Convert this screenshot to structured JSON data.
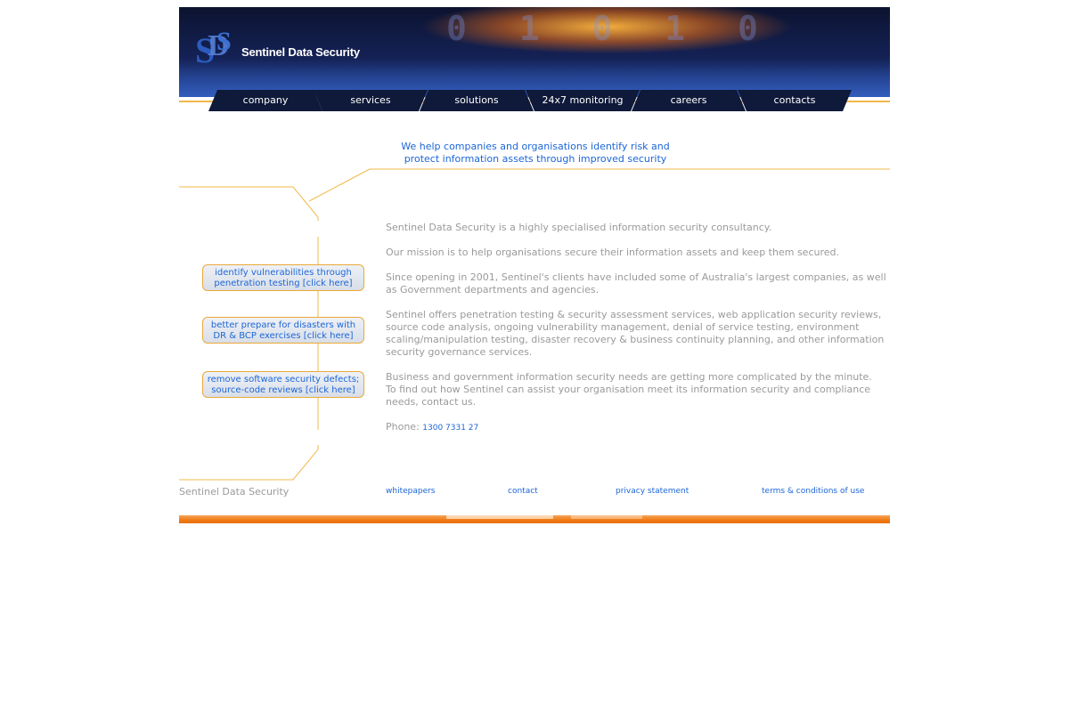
{
  "brand": {
    "name": "Sentinel Data Security"
  },
  "nav": {
    "items": [
      "company",
      "services",
      "solutions",
      "24x7 monitoring",
      "careers",
      "contacts"
    ]
  },
  "tagline": {
    "line1": "We help companies and organisations identify risk and",
    "line2": "protect information assets through improved security"
  },
  "promos": [
    {
      "line1": "identify vulnerabilities through",
      "line2": "penetration testing [click here]"
    },
    {
      "line1": "better prepare for disasters with",
      "line2": "DR & BCP exercises [click here]"
    },
    {
      "line1": "remove software security defects;",
      "line2": "source-code reviews [click here]"
    }
  ],
  "content": {
    "p1": "Sentinel Data Security is a highly specialised information security consultancy.",
    "p2": "Our mission is to help organisations secure their information assets and keep them secured.",
    "p3": "Since opening in 2001, Sentinel's clients have included some of Australia's largest companies, as well as Government departments and agencies.",
    "p4": "Sentinel offers penetration testing & security assessment services, web application security reviews, source code analysis, ongoing vulnerability management, denial of service testing, environment scaling/manipulation testing, disaster recovery & business continuity planning, and other information security governance services.",
    "p5a": "Business and government information security needs are getting more complicated by the minute.",
    "p5b": "To find out how Sentinel can assist your organisation meet its information security and compliance needs, contact us.",
    "phone_label": "Phone:",
    "phone_number": "1300 7331 27"
  },
  "footer": {
    "name": "Sentinel Data Security",
    "links": [
      "whitepapers",
      "contact",
      "privacy statement",
      "terms & conditions of use"
    ]
  },
  "colors": {
    "link": "#1c66d6",
    "accent": "#f2b84a",
    "text": "#9a9a9a",
    "nav_bg": "#0f1a3a"
  }
}
